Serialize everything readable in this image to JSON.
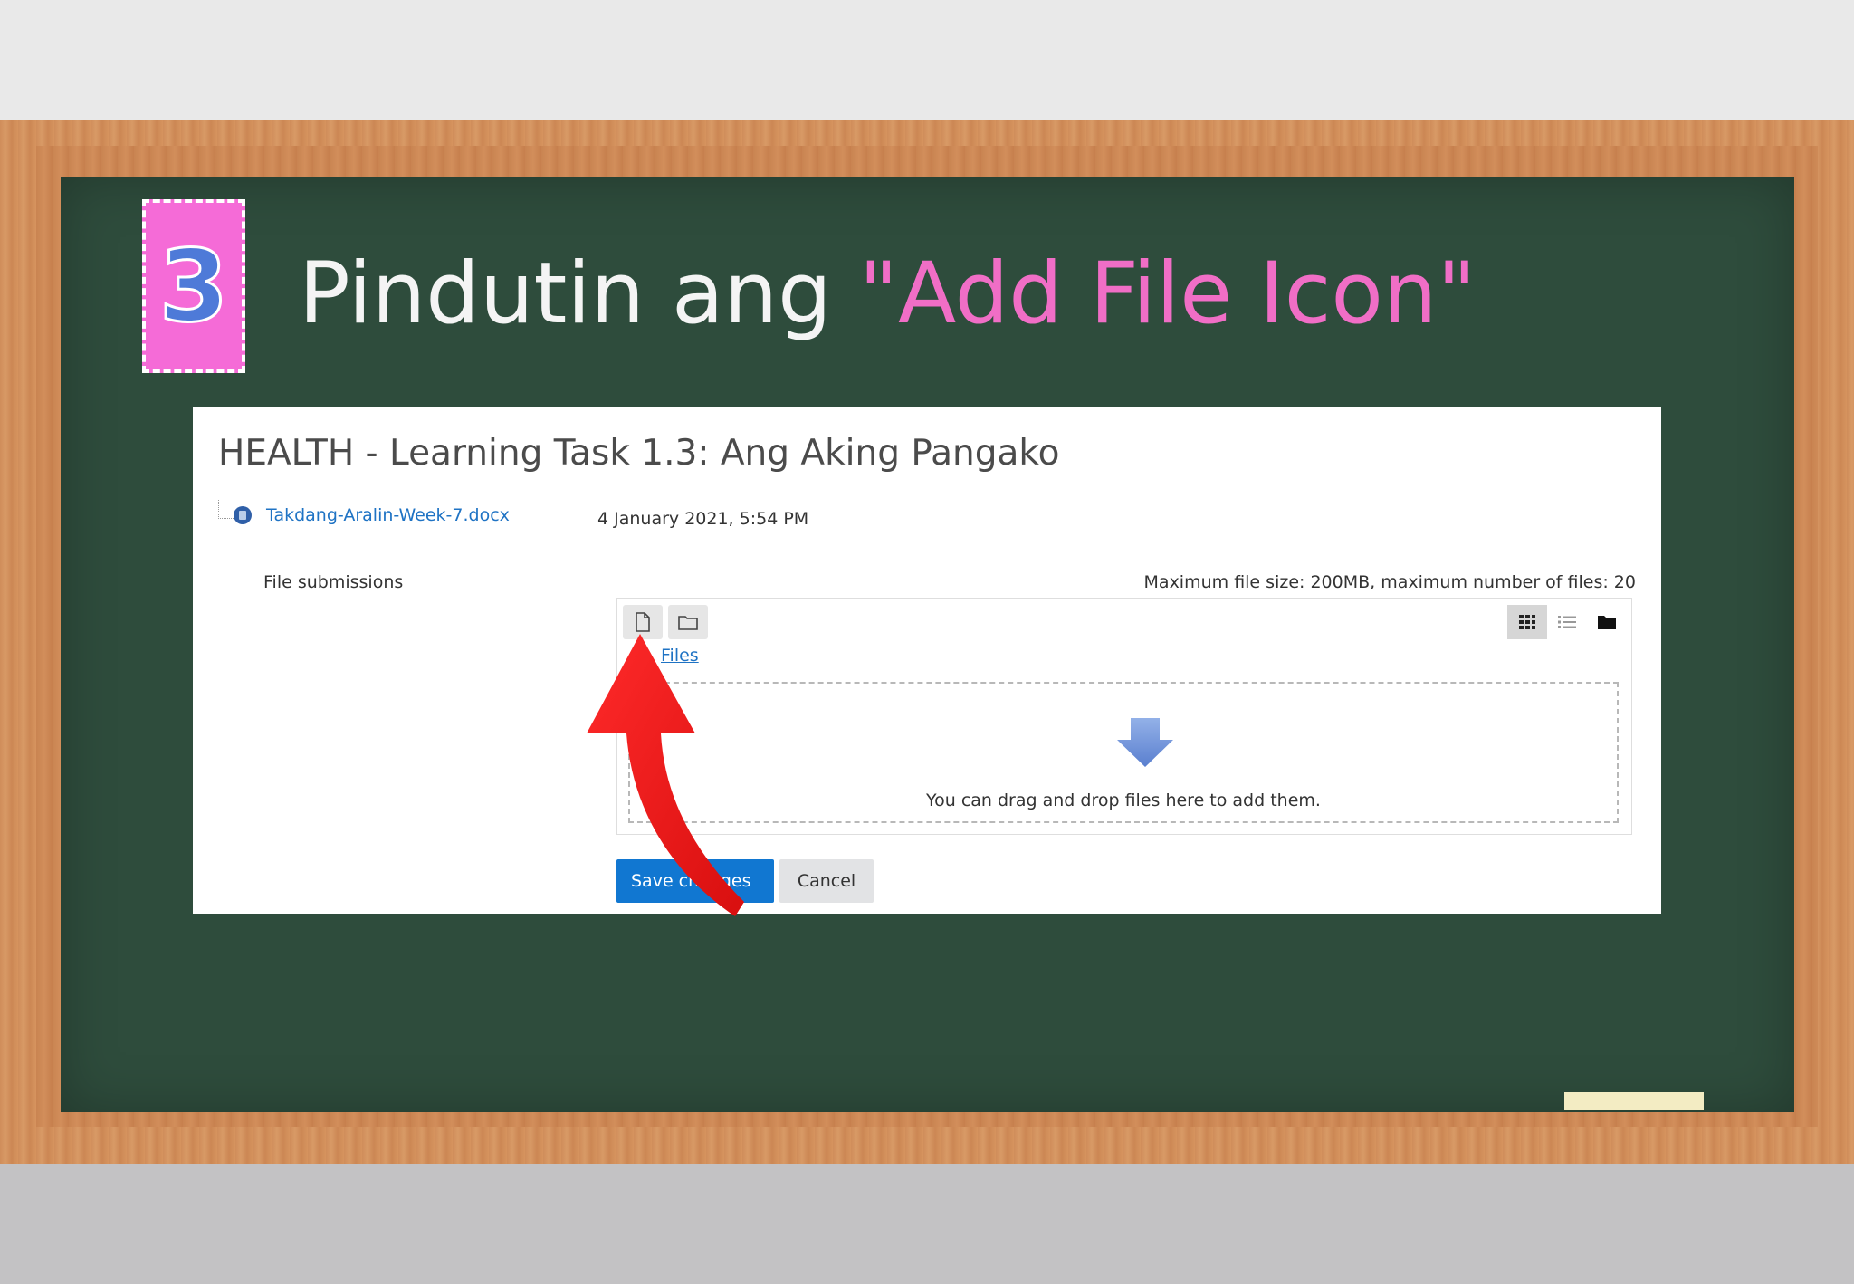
{
  "slide": {
    "step_number": "3",
    "title_white": "Pindutin ang ",
    "title_pink": "\"Add File Icon\""
  },
  "assignment": {
    "heading": "HEALTH - Learning Task 1.3: Ang Aking Pangako",
    "file_name": "Takdang-Aralin-Week-7.docx",
    "file_date": "4 January 2021, 5:54 PM",
    "submissions_label": "File submissions",
    "limits_text": "Maximum file size: 200MB, maximum number of files: 20"
  },
  "filepicker": {
    "path_label": "Files",
    "drop_text": "You can drag and drop files here to add them.",
    "icons": {
      "add_file": "add-file-icon",
      "create_folder": "folder-icon",
      "view_icons": "grid-view-icon",
      "view_list": "list-view-icon",
      "view_tree": "folder-tree-icon"
    }
  },
  "buttons": {
    "save_label": "Save changes",
    "cancel_label": "Cancel"
  },
  "colors": {
    "board": "#2e4c3c",
    "frame": "#d08d5a",
    "badge": "#f56bd7",
    "title_pink": "#f06ec6",
    "primary_button": "#1177d1",
    "pointer_arrow": "#ee1c1c"
  }
}
